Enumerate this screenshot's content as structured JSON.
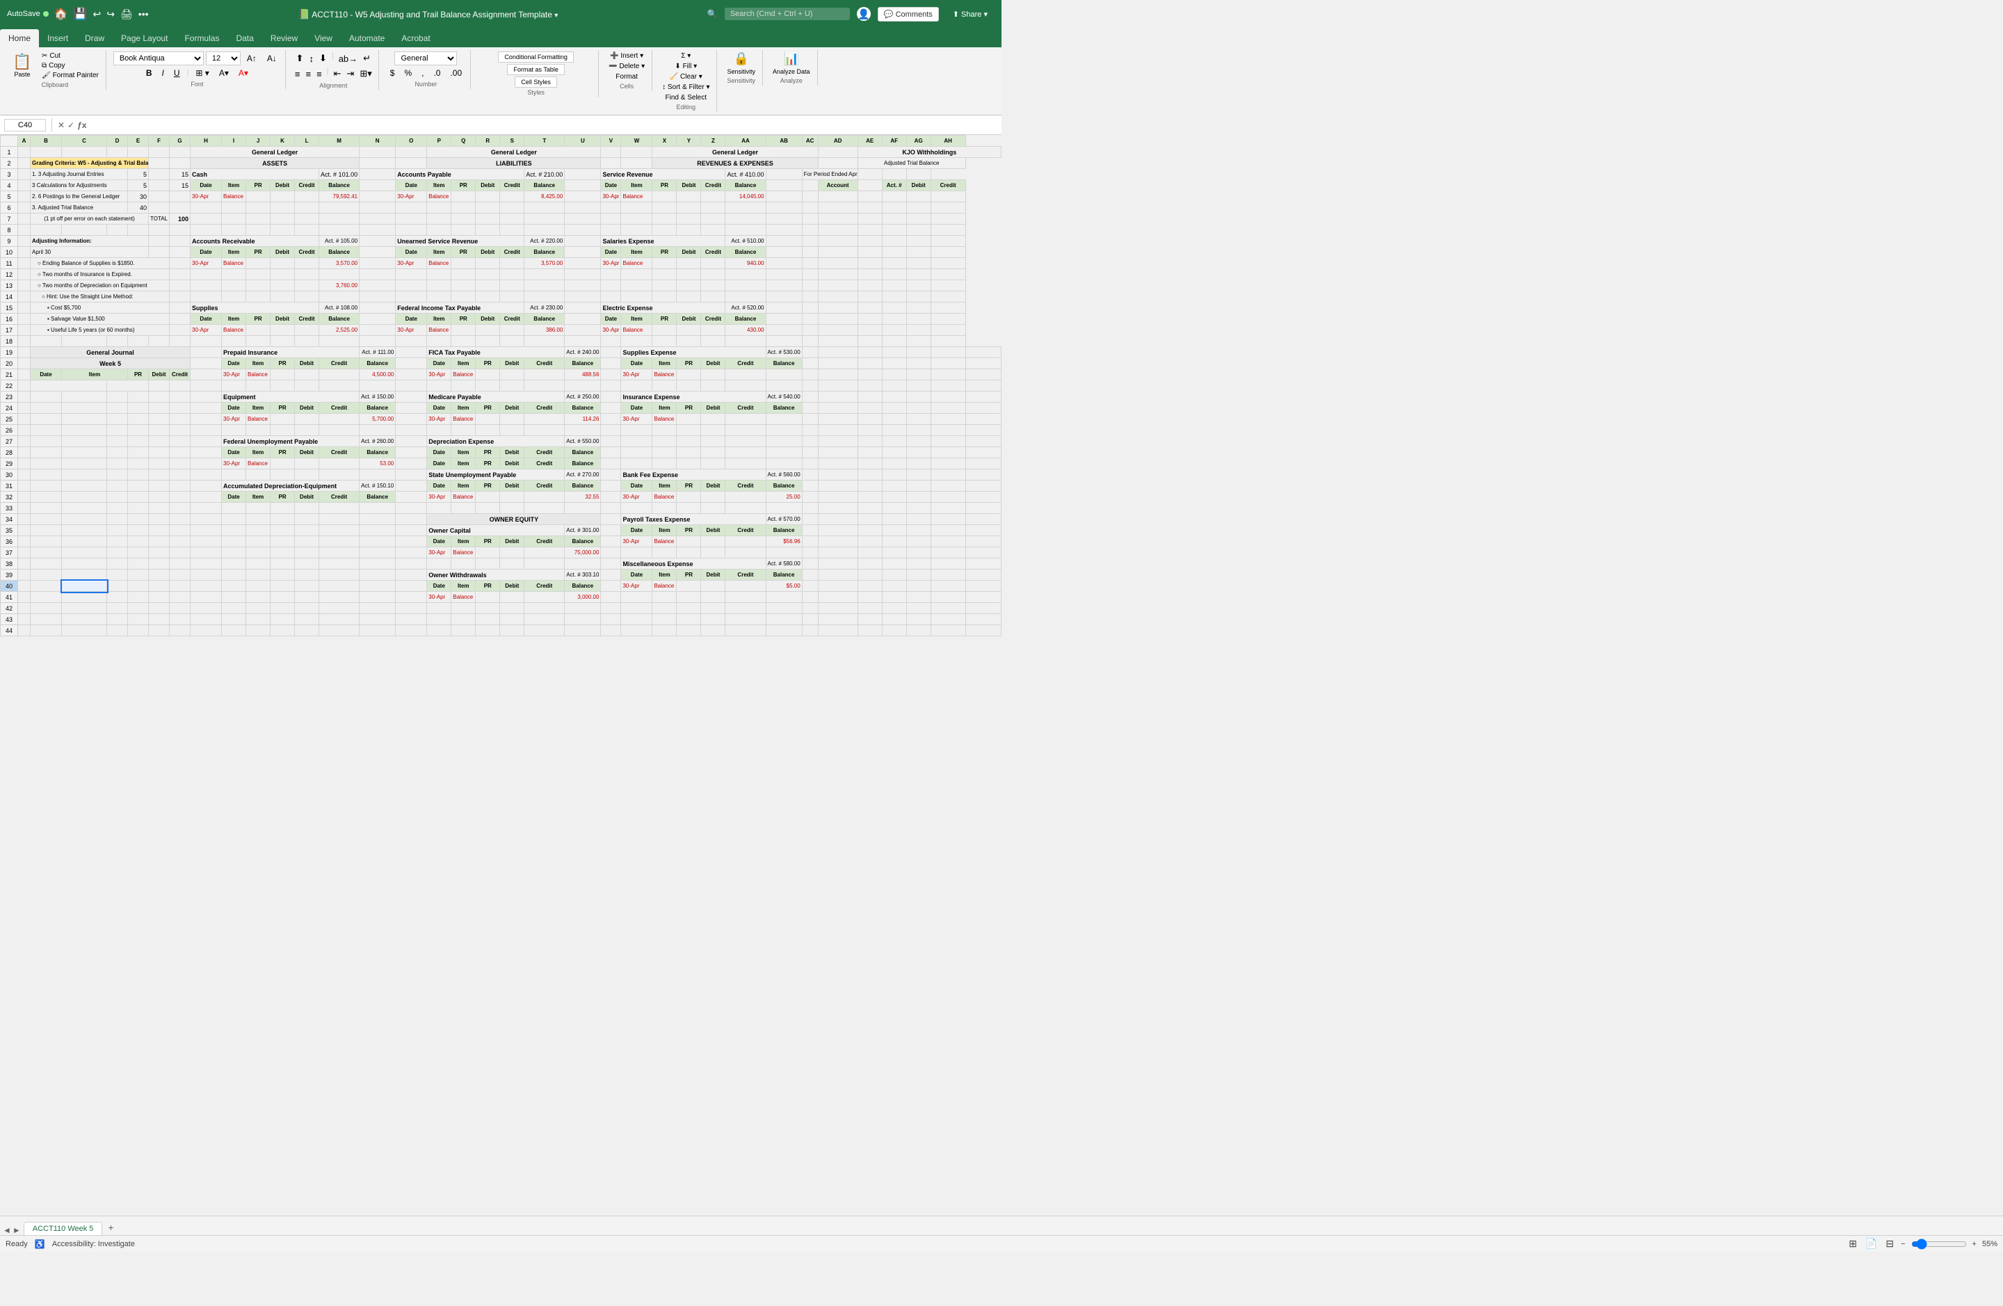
{
  "titleBar": {
    "autosave": "AutoSave",
    "title": "ACCT110 - W5 Adjusting and Trail Balance Assignment Template",
    "searchPlaceholder": "Search (Cmd + Ctrl + U)"
  },
  "ribbonTabs": [
    "Home",
    "Insert",
    "Draw",
    "Page Layout",
    "Formulas",
    "Data",
    "Review",
    "View",
    "Automate",
    "Acrobat"
  ],
  "activeTab": "Home",
  "fontName": "Book Antiqua",
  "fontSize": "12",
  "cellRef": "C40",
  "formulaContent": "",
  "statusBar": {
    "ready": "Ready",
    "accessibility": "Accessibility: Investigate",
    "zoom": "55%"
  },
  "sheetTab": "ACCT110 Week 5",
  "ribbon": {
    "conditionalFormatting": "Conditional Formatting",
    "formatAsTable": "Format as Table",
    "cellStyles": "Cell Styles",
    "format": "Format",
    "findSelect": "Find & Select",
    "analyzeData": "Analyze Data",
    "sensitivity": "Sensitivity"
  }
}
